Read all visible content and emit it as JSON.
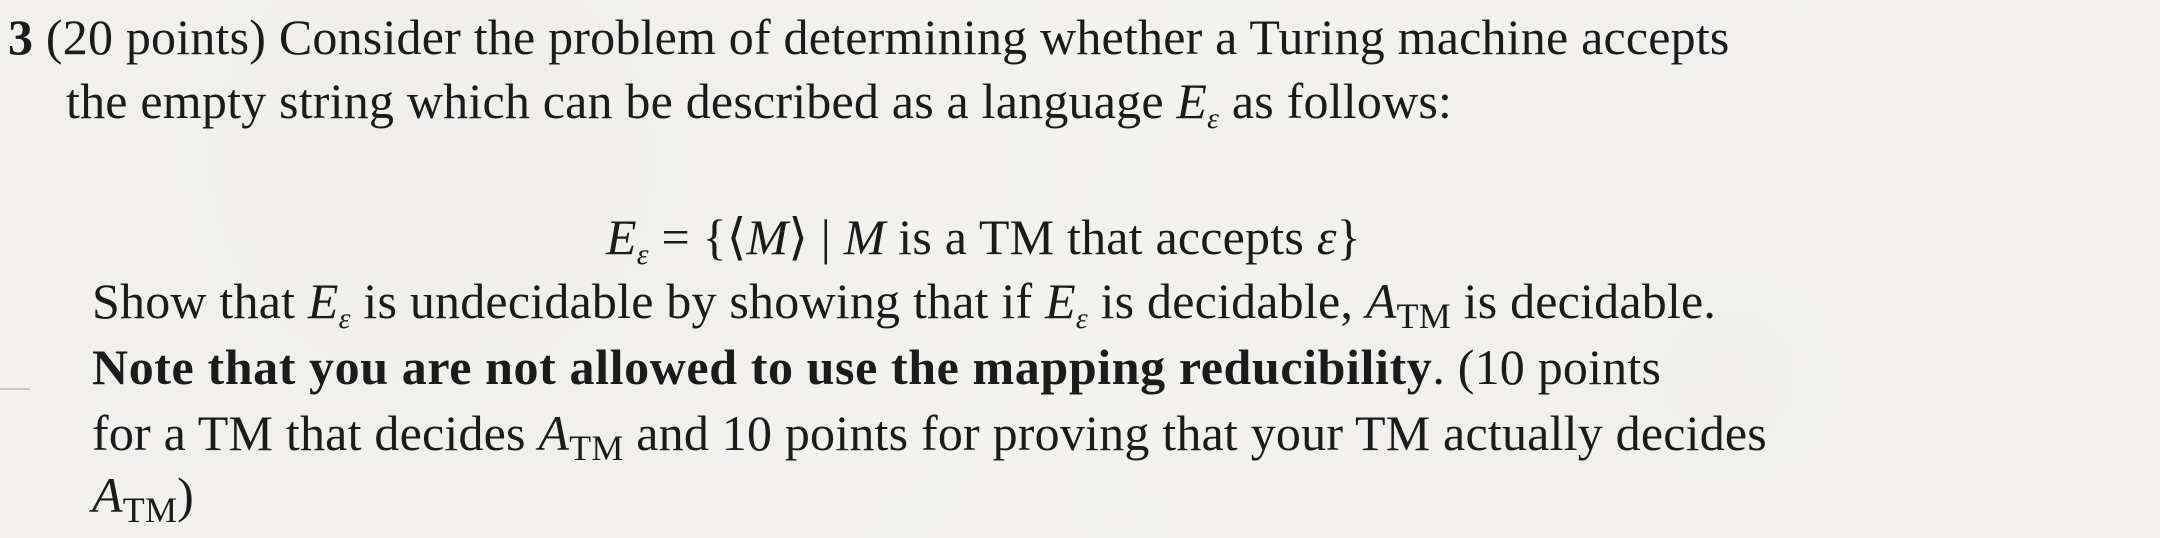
{
  "problem": {
    "number": "3",
    "intro_line1": "(20 points) Consider the problem of determining whether a Turing machine accepts",
    "intro_line2_a": "the empty string which can be described as a language ",
    "E": "E",
    "eps": "ε",
    "intro_line2_b": " as follows:",
    "display_eq": {
      "eq": " = {⟨",
      "M": "M",
      "mid": "⟩ | ",
      "M2": "M",
      "rest": " is a TM that accepts ",
      "close": "}"
    },
    "show_line": {
      "a": "Show that ",
      "b": " is undecidable by showing that if ",
      "c": " is decidable, ",
      "A": "A",
      "TM": "TM",
      "d": " is decidable."
    },
    "note_bold": "Note that you are not allowed to use the mapping reducibility",
    "note_rest": ". (10 points",
    "line7_a": "for a TM that decides ",
    "line7_b": " and 10 points for proving that your TM actually decides",
    "line8_close": ")"
  }
}
